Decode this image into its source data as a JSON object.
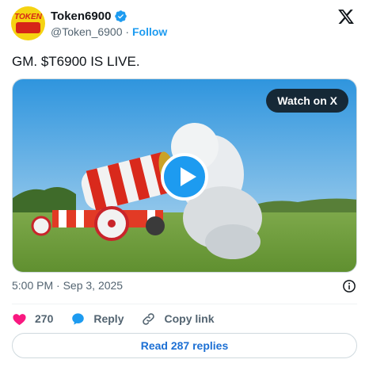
{
  "author": {
    "name": "Token6900",
    "handle": "@Token_6900",
    "separator": "·",
    "follow_label": "Follow",
    "avatar_text": "TOKEN",
    "verified": true
  },
  "tweet": {
    "text": "GM. $T6900 IS LIVE.",
    "watch_label": "Watch on X",
    "timestamp": "5:00 PM · Sep 3, 2025"
  },
  "actions": {
    "likes_count": "270",
    "reply_label": "Reply",
    "copy_link_label": "Copy link"
  },
  "footer": {
    "read_replies_label": "Read 287 replies"
  },
  "icons": [
    "verified-badge-icon",
    "x-logo-icon",
    "play-icon",
    "info-icon",
    "heart-icon",
    "reply-icon",
    "link-icon"
  ],
  "colors": {
    "accent": "#1d9bf0",
    "heart": "#f91880",
    "text_secondary": "#536471",
    "link": "#1d70d4"
  }
}
